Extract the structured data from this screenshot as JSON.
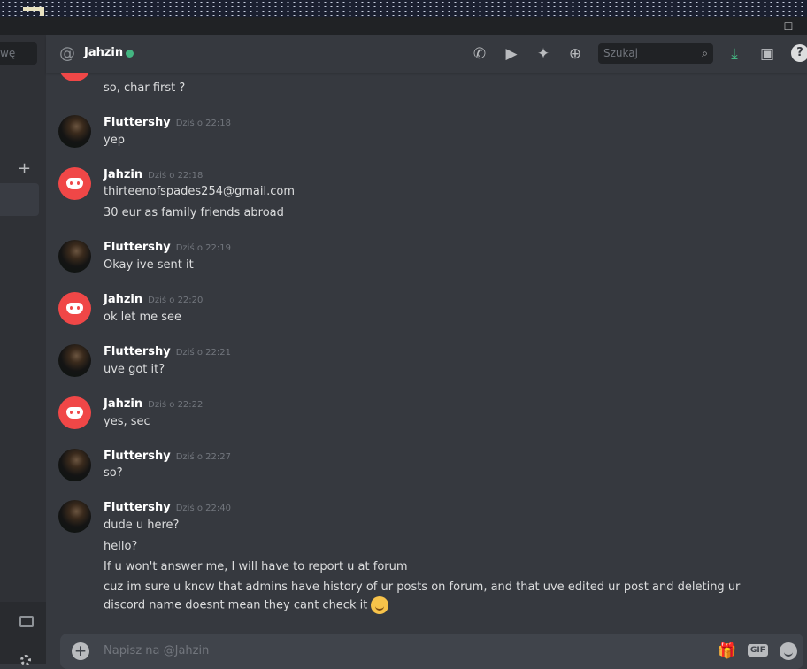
{
  "window": {
    "minimize": "–",
    "maximize": "☐"
  },
  "left_sidebar": {
    "search_text": "wę",
    "add": "+"
  },
  "header": {
    "recipient": "Jahzin",
    "search_placeholder": "Szukaj",
    "help": "?"
  },
  "messages": {
    "top_line": "so, char first ?",
    "groups": [
      {
        "author": "Fluttershy",
        "time": "Dziś o 22:18",
        "avatar": "photo",
        "lines": [
          "yep"
        ]
      },
      {
        "author": "Jahzin",
        "time": "Dziś o 22:18",
        "avatar": "discord",
        "lines": [
          "thirteenofspades254@gmail.com",
          "30 eur as family friends abroad"
        ]
      },
      {
        "author": "Fluttershy",
        "time": "Dziś o 22:19",
        "avatar": "photo",
        "lines": [
          "Okay ive sent it"
        ]
      },
      {
        "author": "Jahzin",
        "time": "Dziś o 22:20",
        "avatar": "discord",
        "lines": [
          "ok let me see"
        ]
      },
      {
        "author": "Fluttershy",
        "time": "Dziś o 22:21",
        "avatar": "photo",
        "lines": [
          "uve got it?"
        ]
      },
      {
        "author": "Jahzin",
        "time": "Dziś o 22:22",
        "avatar": "discord",
        "lines": [
          "yes, sec"
        ]
      },
      {
        "author": "Fluttershy",
        "time": "Dziś o 22:27",
        "avatar": "photo",
        "lines": [
          "so?"
        ]
      },
      {
        "author": "Fluttershy",
        "time": "Dziś o 22:40",
        "avatar": "photo",
        "lines": [
          "dude u here?",
          "hello?",
          "If u won't answer me, I will have to report u at forum",
          "cuz im sure u know that admins have history of ur posts on forum, and that uve edited ur post and deleting ur discord name doesnt mean they cant check it"
        ]
      }
    ]
  },
  "composer": {
    "placeholder": "Napisz na @Jahzin",
    "gif_label": "GIF",
    "add": "+"
  },
  "colors": {
    "background": "#36393f",
    "online": "#43b581",
    "discord_red": "#f04747"
  }
}
